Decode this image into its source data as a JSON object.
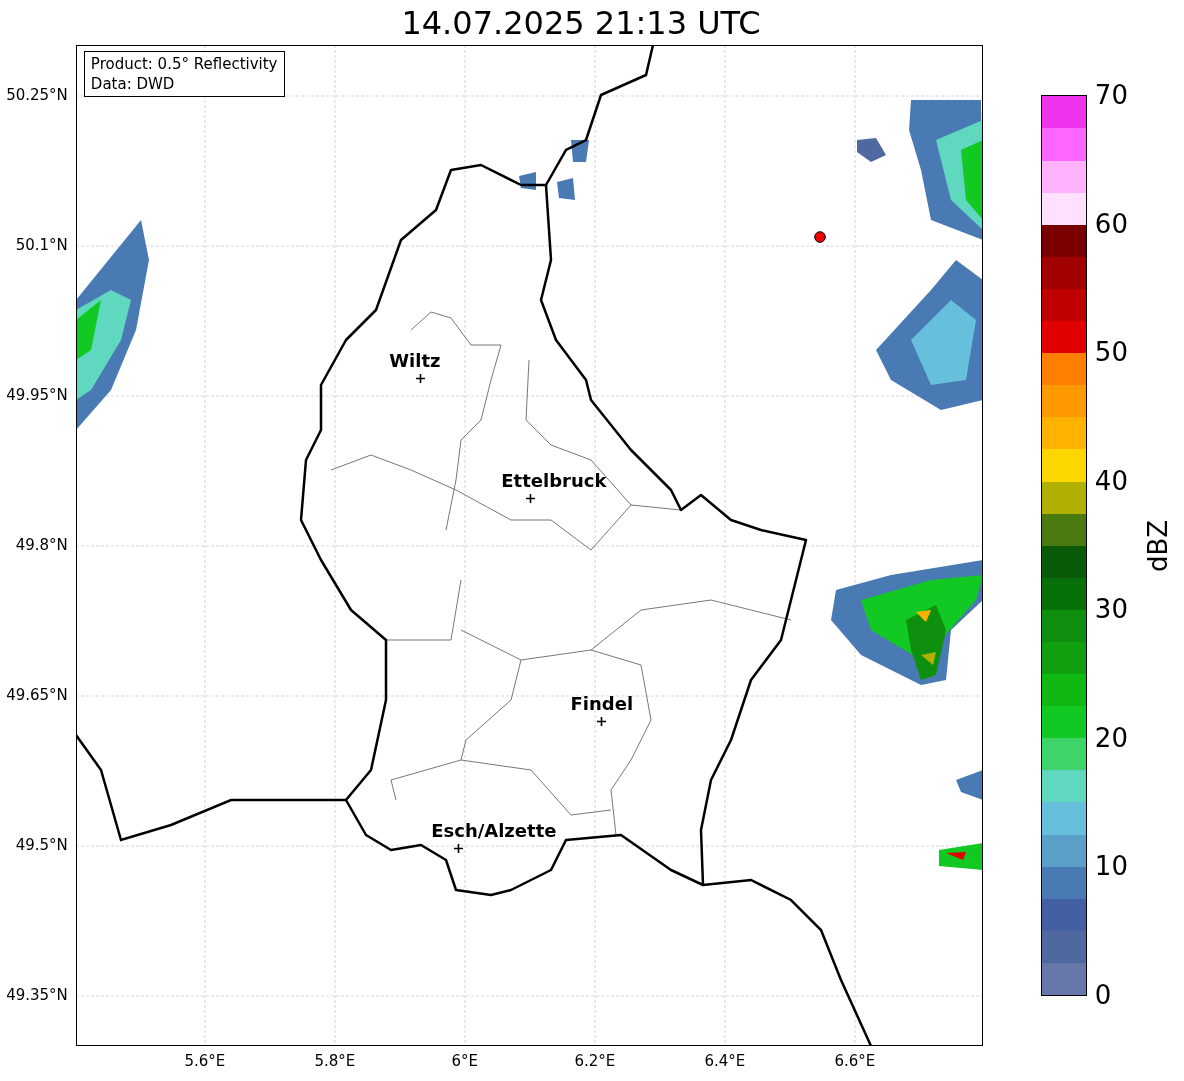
{
  "title": "14.07.2025 21:13 UTC",
  "legend": [
    "Product: 0.5° Reflectivity",
    "Data: DWD"
  ],
  "cities": [
    {
      "name": "Wiltz"
    },
    {
      "name": "Ettelbruck"
    },
    {
      "name": "Findel"
    },
    {
      "name": "Esch/Alzette"
    }
  ],
  "y_ticks": [
    "50.25°N",
    "50.1°N",
    "49.95°N",
    "49.8°N",
    "49.65°N",
    "49.5°N",
    "49.35°N"
  ],
  "x_ticks": [
    "5.6°E",
    "5.8°E",
    "6°E",
    "6.2°E",
    "6.4°E",
    "6.6°E"
  ],
  "colorbar": {
    "label": "dBZ",
    "ticks": [
      "70",
      "60",
      "50",
      "40",
      "30",
      "20",
      "10",
      "0"
    ],
    "bands": [
      {
        "color": "#6677aa"
      },
      {
        "color": "#5068a0"
      },
      {
        "color": "#4460a4"
      },
      {
        "color": "#4a7ab4"
      },
      {
        "color": "#5aa0c8"
      },
      {
        "color": "#66c0dc"
      },
      {
        "color": "#60d8c0"
      },
      {
        "color": "#3ed46a"
      },
      {
        "color": "#12c822"
      },
      {
        "color": "#12b812"
      },
      {
        "color": "#10a010"
      },
      {
        "color": "#0e900e"
      },
      {
        "color": "#087008"
      },
      {
        "color": "#0a5a0a"
      },
      {
        "color": "#4a7a10"
      },
      {
        "color": "#b0b000"
      },
      {
        "color": "#ffd700"
      },
      {
        "color": "#ffb300"
      },
      {
        "color": "#ff9900"
      },
      {
        "color": "#ff7f00"
      },
      {
        "color": "#e00000"
      },
      {
        "color": "#c00000"
      },
      {
        "color": "#a00000"
      },
      {
        "color": "#7a0000"
      },
      {
        "color": "#ffe0ff"
      },
      {
        "color": "#ffb3ff"
      },
      {
        "color": "#ff66ff"
      },
      {
        "color": "#ee33ee"
      }
    ]
  }
}
